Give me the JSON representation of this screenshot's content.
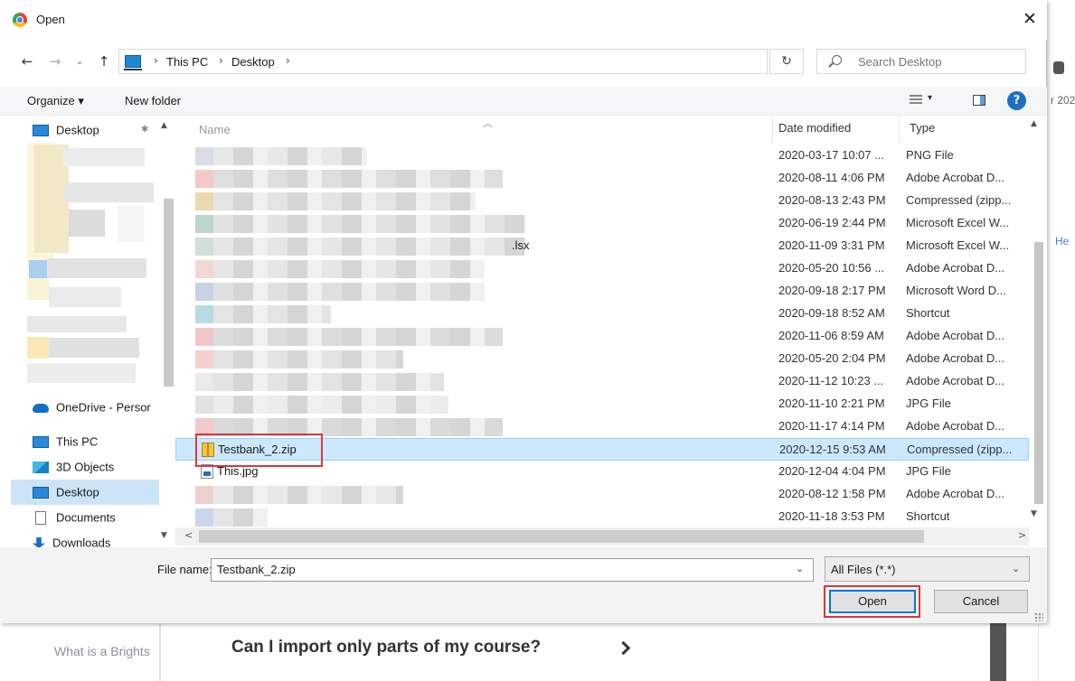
{
  "dialog": {
    "title": "Open",
    "close_glyph": "✕"
  },
  "nav": {
    "back_glyph": "←",
    "forward_glyph": "→",
    "recent_glyph": "⌄",
    "up_glyph": "↑",
    "breadcrumb": [
      "This PC",
      "Desktop"
    ],
    "crumb_sep": "›",
    "dropdown_glyph": "⌄",
    "refresh_glyph": "↻",
    "search_placeholder": "Search Desktop"
  },
  "toolbar": {
    "organize_label": "Organize ▾",
    "new_folder_label": "New folder",
    "views_dd_glyph": "▾",
    "help_glyph": "?"
  },
  "navpane": {
    "items": [
      {
        "label": "Desktop",
        "icon": "desktop-icon"
      },
      {
        "label": "OneDrive - Persor",
        "icon": "onedrive-icon"
      },
      {
        "label": "This PC",
        "icon": "this-pc-icon"
      },
      {
        "label": "3D Objects",
        "icon": "3d-objects-icon"
      },
      {
        "label": "Desktop",
        "icon": "desktop-icon",
        "selected": true
      },
      {
        "label": "Documents",
        "icon": "documents-icon"
      },
      {
        "label": "Downloads",
        "icon": "downloads-icon"
      }
    ],
    "pin_glyph": "📌",
    "scroll_up": "▲",
    "scroll_down": "▼"
  },
  "filelist": {
    "columns": {
      "name": "Name",
      "date": "Date modified",
      "type": "Type"
    },
    "sort_glyph": "︿",
    "rows": [
      {
        "name": "",
        "date": "2020-03-17 10:07 ...",
        "type": "PNG File"
      },
      {
        "name": "",
        "date": "2020-08-11 4:06 PM",
        "type": "Adobe Acrobat D..."
      },
      {
        "name": "",
        "date": "2020-08-13 2:43 PM",
        "type": "Compressed (zipp..."
      },
      {
        "name": "",
        "date": "2020-06-19 2:44 PM",
        "type": "Microsoft Excel W..."
      },
      {
        "name": ".lsx",
        "date": "2020-11-09 3:31 PM",
        "type": "Microsoft Excel W..."
      },
      {
        "name": "",
        "date": "2020-05-20 10:56 ...",
        "type": "Adobe Acrobat D..."
      },
      {
        "name": "",
        "date": "2020-09-18 2:17 PM",
        "type": "Microsoft Word D..."
      },
      {
        "name": "",
        "date": "2020-09-18 8:52 AM",
        "type": "Shortcut"
      },
      {
        "name": "",
        "date": "2020-11-06 8:59 AM",
        "type": "Adobe Acrobat D..."
      },
      {
        "name": "",
        "date": "2020-05-20 2:04 PM",
        "type": "Adobe Acrobat D..."
      },
      {
        "name": "",
        "date": "2020-11-12 10:23 ...",
        "type": "Adobe Acrobat D..."
      },
      {
        "name": "",
        "date": "2020-11-10 2:21 PM",
        "type": "JPG File"
      },
      {
        "name": "",
        "date": "2020-11-17 4:14 PM",
        "type": "Adobe Acrobat D..."
      },
      {
        "name": "Testbank_2.zip",
        "date": "2020-12-15 9:53 AM",
        "type": "Compressed (zipp...",
        "selected": true
      },
      {
        "name": "This.jpg",
        "date": "2020-12-04 4:04 PM",
        "type": "JPG File"
      },
      {
        "name": "",
        "date": "2020-08-12 1:58 PM",
        "type": "Adobe Acrobat D..."
      },
      {
        "name": "",
        "date": "2020-11-18 3:53 PM",
        "type": "Shortcut"
      }
    ],
    "scroll_up": "▲",
    "scroll_down": "▼",
    "hscroll_left": "<",
    "hscroll_right": ">"
  },
  "bottom": {
    "filename_label": "File name:",
    "filename_value": "Testbank_2.zip",
    "filename_dd": "⌄",
    "filter_label": "All Files (*.*)",
    "filter_dd": "⌄",
    "open_label": "Open",
    "cancel_label": "Cancel"
  },
  "background_page": {
    "left_link": "What is a Brights",
    "heading": "Can I import only parts of my course?",
    "right_frag_1": "r 202",
    "right_frag_2": "He"
  },
  "colors": {
    "selection": "#cce8ff",
    "annotation": "#d9363e",
    "accent": "#0078d7"
  }
}
